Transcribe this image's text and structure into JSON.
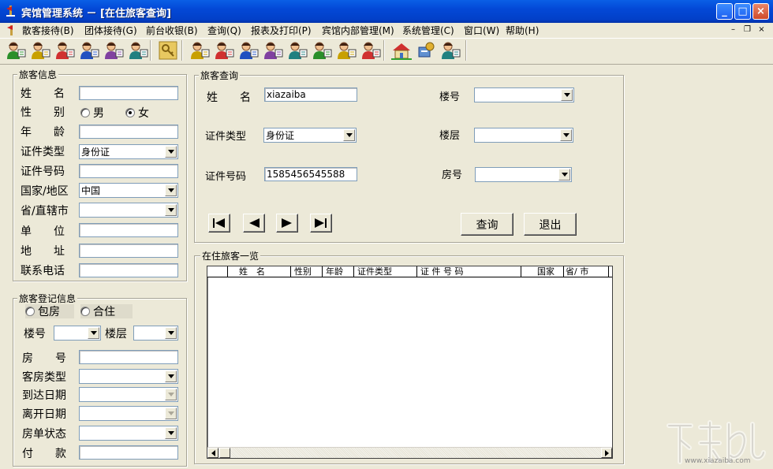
{
  "window": {
    "title": "宾馆管理系统 － [在住旅客查询]",
    "controls": [
      "_",
      "□",
      "×"
    ]
  },
  "menu": [
    {
      "label": "散客接待(B)"
    },
    {
      "label": "团体接待(G)"
    },
    {
      "label": "前台收银(B)"
    },
    {
      "label": "查询(Q)"
    },
    {
      "label": "报表及打印(P)"
    },
    {
      "label": "宾馆内部管理(M)"
    },
    {
      "label": "系统管理(C)"
    },
    {
      "label": "窗口(W)"
    },
    {
      "label": "帮助(H)"
    }
  ],
  "toolbar": {
    "icons": [
      "guest-checkin-icon",
      "guest-checkout-icon",
      "guest-transfer-icon",
      "group-checkin-icon",
      "group-checkout-icon",
      "group-transfer-icon",
      "key-icon",
      "query-guest-icon",
      "query-room-icon",
      "query-bill-icon",
      "report-icon",
      "print-icon",
      "staff-icon",
      "inventory-icon",
      "settings-icon",
      "home-icon",
      "tools-icon",
      "user-icon"
    ]
  },
  "guest_info": {
    "title": "旅客信息",
    "name_label": "姓　　名",
    "gender_label": "性　　别",
    "gender_male": "男",
    "gender_female": "女",
    "gender_selected": "女",
    "age_label": "年　　龄",
    "id_type_label": "证件类型",
    "id_type_value": "身份证",
    "id_number_label": "证件号码",
    "country_label": "国家/地区",
    "country_value": "中国",
    "province_label": "省/直辖市",
    "company_label": "单　　位",
    "address_label": "地　　址",
    "phone_label": "联系电话"
  },
  "registration": {
    "title": "旅客登记信息",
    "option_whole": "包房",
    "option_share": "合住",
    "building_label": "楼号",
    "floor_label": "楼层",
    "room_label": "房　　号",
    "room_type_label": "客房类型",
    "arrival_label": "到达日期",
    "departure_label": "离开日期",
    "status_label": "房单状态",
    "payment_label": "付　　款"
  },
  "query": {
    "title": "旅客查询",
    "name_label": "姓　　名",
    "name_value": "xiazaiba",
    "id_type_label": "证件类型",
    "id_type_value": "身份证",
    "id_number_label": "证件号码",
    "id_number_value": "1585456545588",
    "building_label": "楼号",
    "floor_label": "楼层",
    "room_label": "房号",
    "search_button": "查询",
    "exit_button": "退出"
  },
  "guest_list": {
    "title": "在住旅客一览",
    "columns": [
      "姓　名",
      "性别",
      "年龄",
      "证件类型",
      "证 件 号 码",
      "国家",
      "省/ 市"
    ]
  },
  "watermark": {
    "url": "www.xiazaiba.com"
  }
}
